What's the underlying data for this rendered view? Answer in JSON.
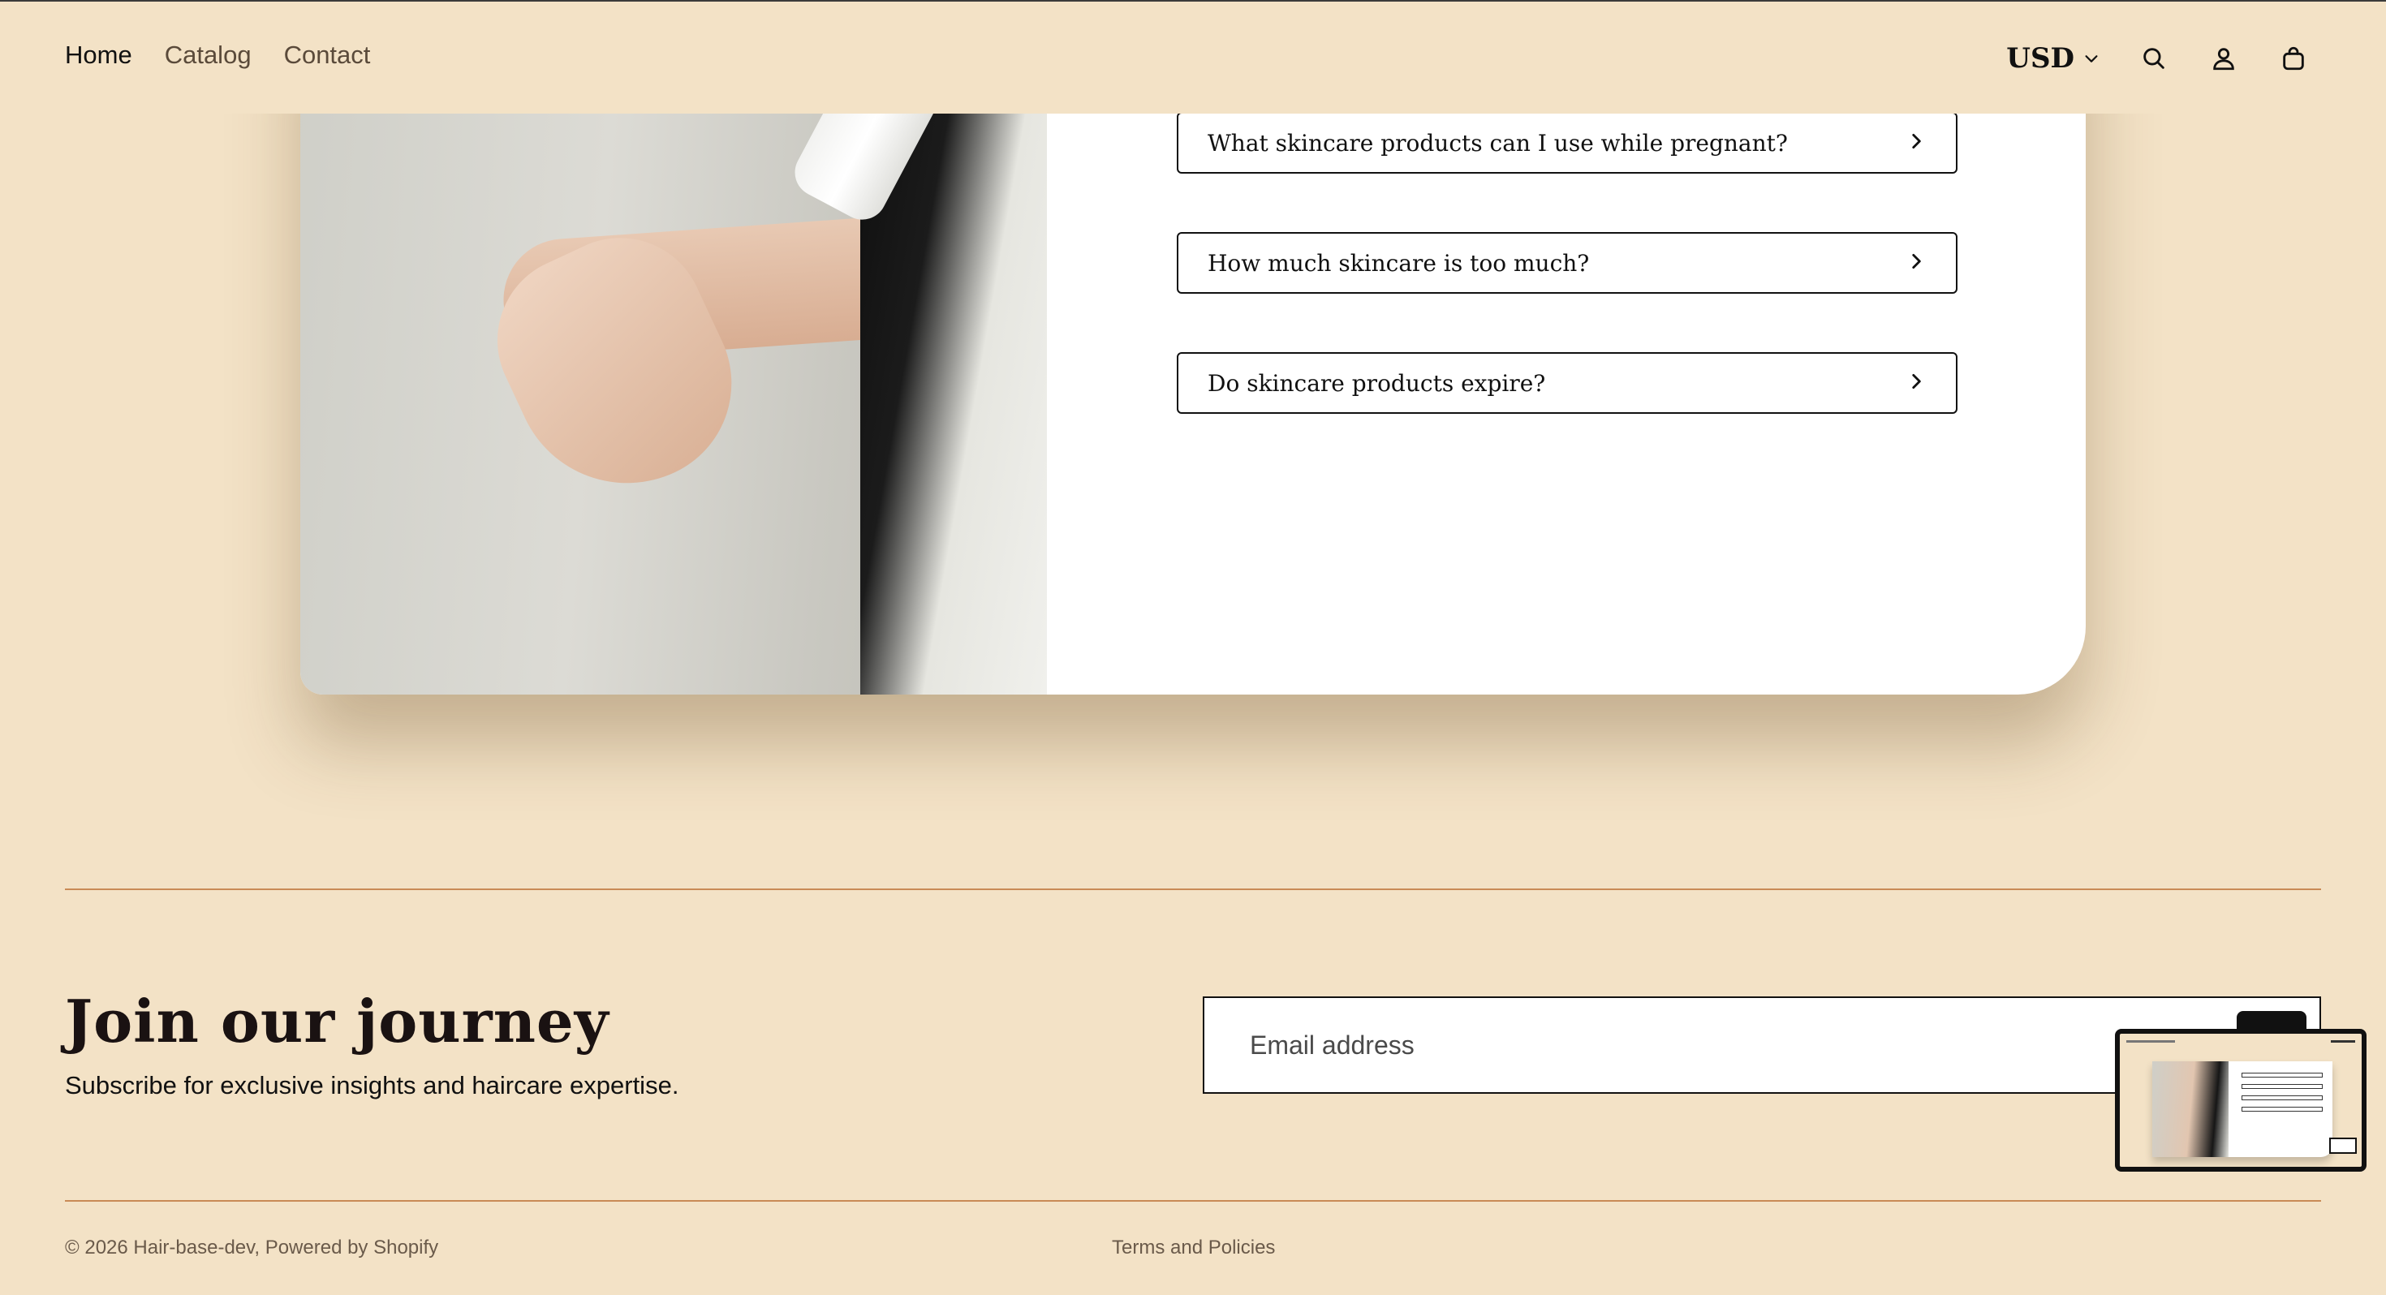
{
  "header": {
    "nav": [
      {
        "label": "Home",
        "active": true
      },
      {
        "label": "Catalog",
        "active": false
      },
      {
        "label": "Contact",
        "active": false
      }
    ],
    "currency": "USD",
    "icons": [
      "chevron-down-icon",
      "search-icon",
      "account-icon",
      "cart-icon"
    ]
  },
  "faq": {
    "items": [
      {
        "question": "What skincare products can I use while pregnant?"
      },
      {
        "question": "How much skincare is too much?"
      },
      {
        "question": "Do skincare products expire?"
      }
    ]
  },
  "newsletter": {
    "title": "Join our journey",
    "subtitle": "Subscribe for exclusive insights and haircare expertise.",
    "email_placeholder": "Email address"
  },
  "footer": {
    "copyright": "© 2026 Hair-base-dev, Powered by Shopify",
    "policies": "Terms and Policies"
  },
  "colors": {
    "background": "#f3e2c6",
    "divider": "#c98a56",
    "text": "#1a1a1a"
  }
}
